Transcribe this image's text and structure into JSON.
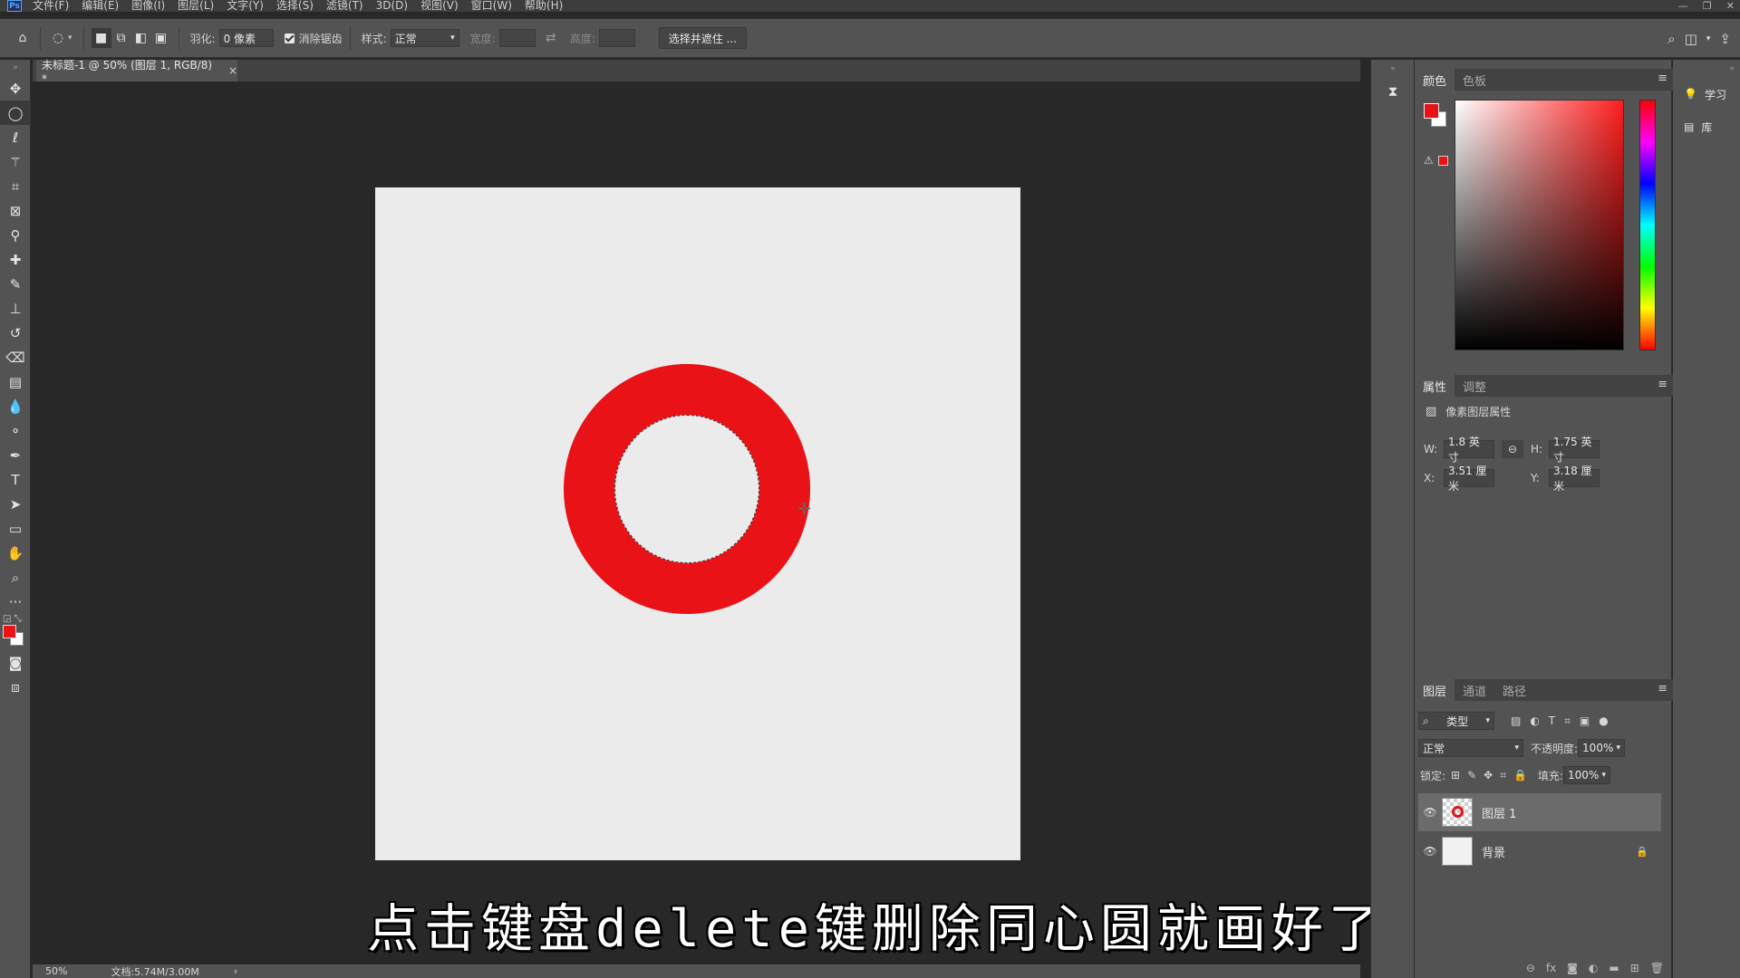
{
  "app": {
    "logo": "Ps"
  },
  "menu": [
    "文件(F)",
    "编辑(E)",
    "图像(I)",
    "图层(L)",
    "文字(Y)",
    "选择(S)",
    "滤镜(T)",
    "3D(D)",
    "视图(V)",
    "窗口(W)",
    "帮助(H)"
  ],
  "window_controls": [
    "—",
    "❐",
    "✕"
  ],
  "options": {
    "feather_label": "羽化:",
    "feather_value": "0 像素",
    "antialias_label": "消除锯齿",
    "style_label": "样式:",
    "style_value": "正常",
    "width_label": "宽度:",
    "height_label": "高度:",
    "select_mask_button": "选择并遮住 ..."
  },
  "document": {
    "tab_title": "未标题-1 @ 50% (图层 1, RGB/8) *",
    "close": "×"
  },
  "subtitle": "点击键盘delete键删除同心圆就画好了",
  "status": {
    "zoom": "50%",
    "doc_size": "文档:5.74M/3.00M",
    "arrow": "›"
  },
  "color_panel": {
    "tabs": [
      "颜色",
      "色板"
    ],
    "fg_color": "#e91216",
    "bg_color": "#ffffff"
  },
  "properties_panel": {
    "tabs": [
      "属性",
      "调整"
    ],
    "title": "像素图层属性",
    "w_label": "W:",
    "w_value": "1.8 英寸",
    "h_label": "H:",
    "h_value": "1.75 英寸",
    "x_label": "X:",
    "x_value": "3.51 厘米",
    "y_label": "Y:",
    "y_value": "3.18 厘米"
  },
  "layers_panel": {
    "tabs": [
      "图层",
      "通道",
      "路径"
    ],
    "filter_kind": "类型",
    "blend_mode": "正常",
    "opacity_label": "不透明度:",
    "opacity_value": "100%",
    "lock_label": "锁定:",
    "fill_label": "填充:",
    "fill_value": "100%",
    "layers": [
      {
        "name": "图层 1",
        "selected": true
      },
      {
        "name": "背景",
        "selected": false
      }
    ]
  },
  "learn_strip": {
    "learn": "学习",
    "library": "库"
  }
}
